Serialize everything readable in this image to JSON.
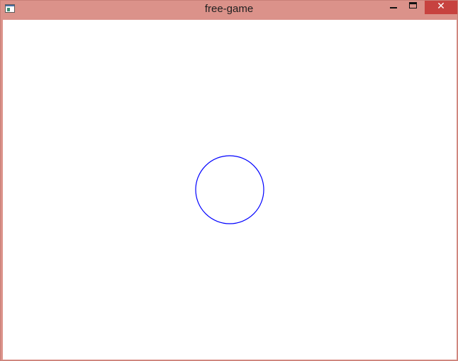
{
  "window": {
    "title": "free-game"
  },
  "titlebar": {
    "icons": {
      "app": "app-window-icon",
      "minimize": "minimize-icon",
      "maximize": "maximize-icon",
      "close": "close-icon"
    },
    "close_glyph": "✕",
    "colors": {
      "frame": "#db928a",
      "close_button": "#c7423f"
    }
  },
  "scene": {
    "background": "#ffffff",
    "objects": [
      {
        "shape": "circle",
        "stroke": "#0000ff",
        "fill": "none"
      }
    ]
  }
}
